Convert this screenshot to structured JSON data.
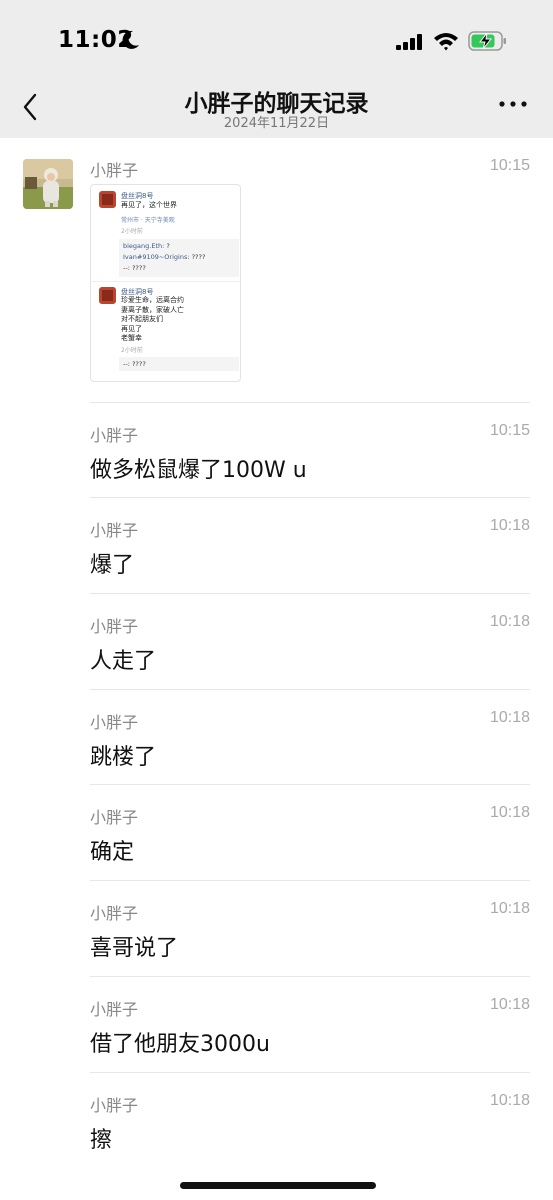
{
  "status_bar": {
    "time": "11:02"
  },
  "nav": {
    "title": "小胖子的聊天记录",
    "subtitle": "2024年11月22日"
  },
  "image_card": {
    "post1": {
      "author": "盘丝洞8号",
      "text": "再见了，这个世界",
      "location": "常州市 · 天宁寺美观",
      "time": "2小时前",
      "comments": [
        {
          "name": "biegang.Eth:",
          "text": "?"
        },
        {
          "name": "Ivan#9109~Origins:",
          "text": "????"
        },
        {
          "name": "--:",
          "text": "????"
        }
      ]
    },
    "post2": {
      "author": "盘丝洞8号",
      "lines": [
        "珍爱生命，远离合约",
        "妻离子散，家破人亡",
        "对不起朋友们",
        "再见了",
        "老蟹幸"
      ],
      "time": "2小时前",
      "comments": [
        {
          "name": "--:",
          "text": "????"
        }
      ]
    }
  },
  "messages": [
    {
      "sender": "小胖子",
      "time": "10:15",
      "text": ""
    },
    {
      "sender": "小胖子",
      "time": "10:15",
      "text": "做多松鼠爆了100W u"
    },
    {
      "sender": "小胖子",
      "time": "10:18",
      "text": "爆了"
    },
    {
      "sender": "小胖子",
      "time": "10:18",
      "text": "人走了"
    },
    {
      "sender": "小胖子",
      "time": "10:18",
      "text": "跳楼了"
    },
    {
      "sender": "小胖子",
      "time": "10:18",
      "text": "确定"
    },
    {
      "sender": "小胖子",
      "time": "10:18",
      "text": "喜哥说了"
    },
    {
      "sender": "小胖子",
      "time": "10:18",
      "text": "借了他朋友3000u"
    },
    {
      "sender": "小胖子",
      "time": "10:18",
      "text": "擦"
    }
  ],
  "colors": {
    "header_bg": "#ededed",
    "battery_fill": "#34c759"
  }
}
